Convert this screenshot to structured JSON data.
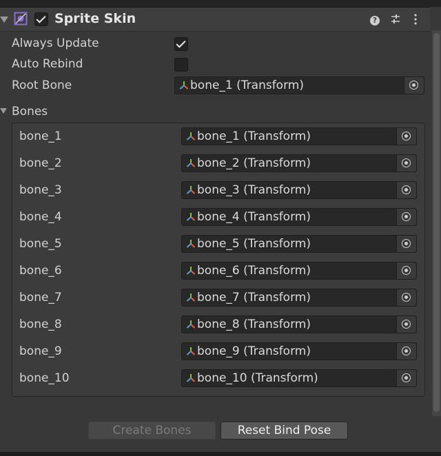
{
  "component": {
    "title": "Sprite Skin",
    "enabled": true
  },
  "properties": {
    "always_update": {
      "label": "Always Update",
      "checked": true
    },
    "auto_rebind": {
      "label": "Auto Rebind",
      "checked": false
    },
    "root_bone": {
      "label": "Root Bone",
      "value": "bone_1 (Transform)"
    }
  },
  "bones": {
    "label": "Bones",
    "items": [
      {
        "label": "bone_1",
        "value": "bone_1 (Transform)"
      },
      {
        "label": "bone_2",
        "value": "bone_2 (Transform)"
      },
      {
        "label": "bone_3",
        "value": "bone_3 (Transform)"
      },
      {
        "label": "bone_4",
        "value": "bone_4 (Transform)"
      },
      {
        "label": "bone_5",
        "value": "bone_5 (Transform)"
      },
      {
        "label": "bone_6",
        "value": "bone_6 (Transform)"
      },
      {
        "label": "bone_7",
        "value": "bone_7 (Transform)"
      },
      {
        "label": "bone_8",
        "value": "bone_8 (Transform)"
      },
      {
        "label": "bone_9",
        "value": "bone_9 (Transform)"
      },
      {
        "label": "bone_10",
        "value": "bone_10 (Transform)"
      }
    ]
  },
  "buttons": {
    "create_bones": "Create Bones",
    "reset_bind_pose": "Reset Bind Pose"
  },
  "icons": {
    "component": "sprite-skin-icon",
    "help": "help-icon",
    "presets": "preset-sliders-icon",
    "menu": "kebab-menu-icon",
    "transform": "transform-axes-icon",
    "picker": "object-picker-icon"
  },
  "colors": {
    "background": "#383838",
    "field": "#282828",
    "accent_icon": "#8a6fd1"
  }
}
